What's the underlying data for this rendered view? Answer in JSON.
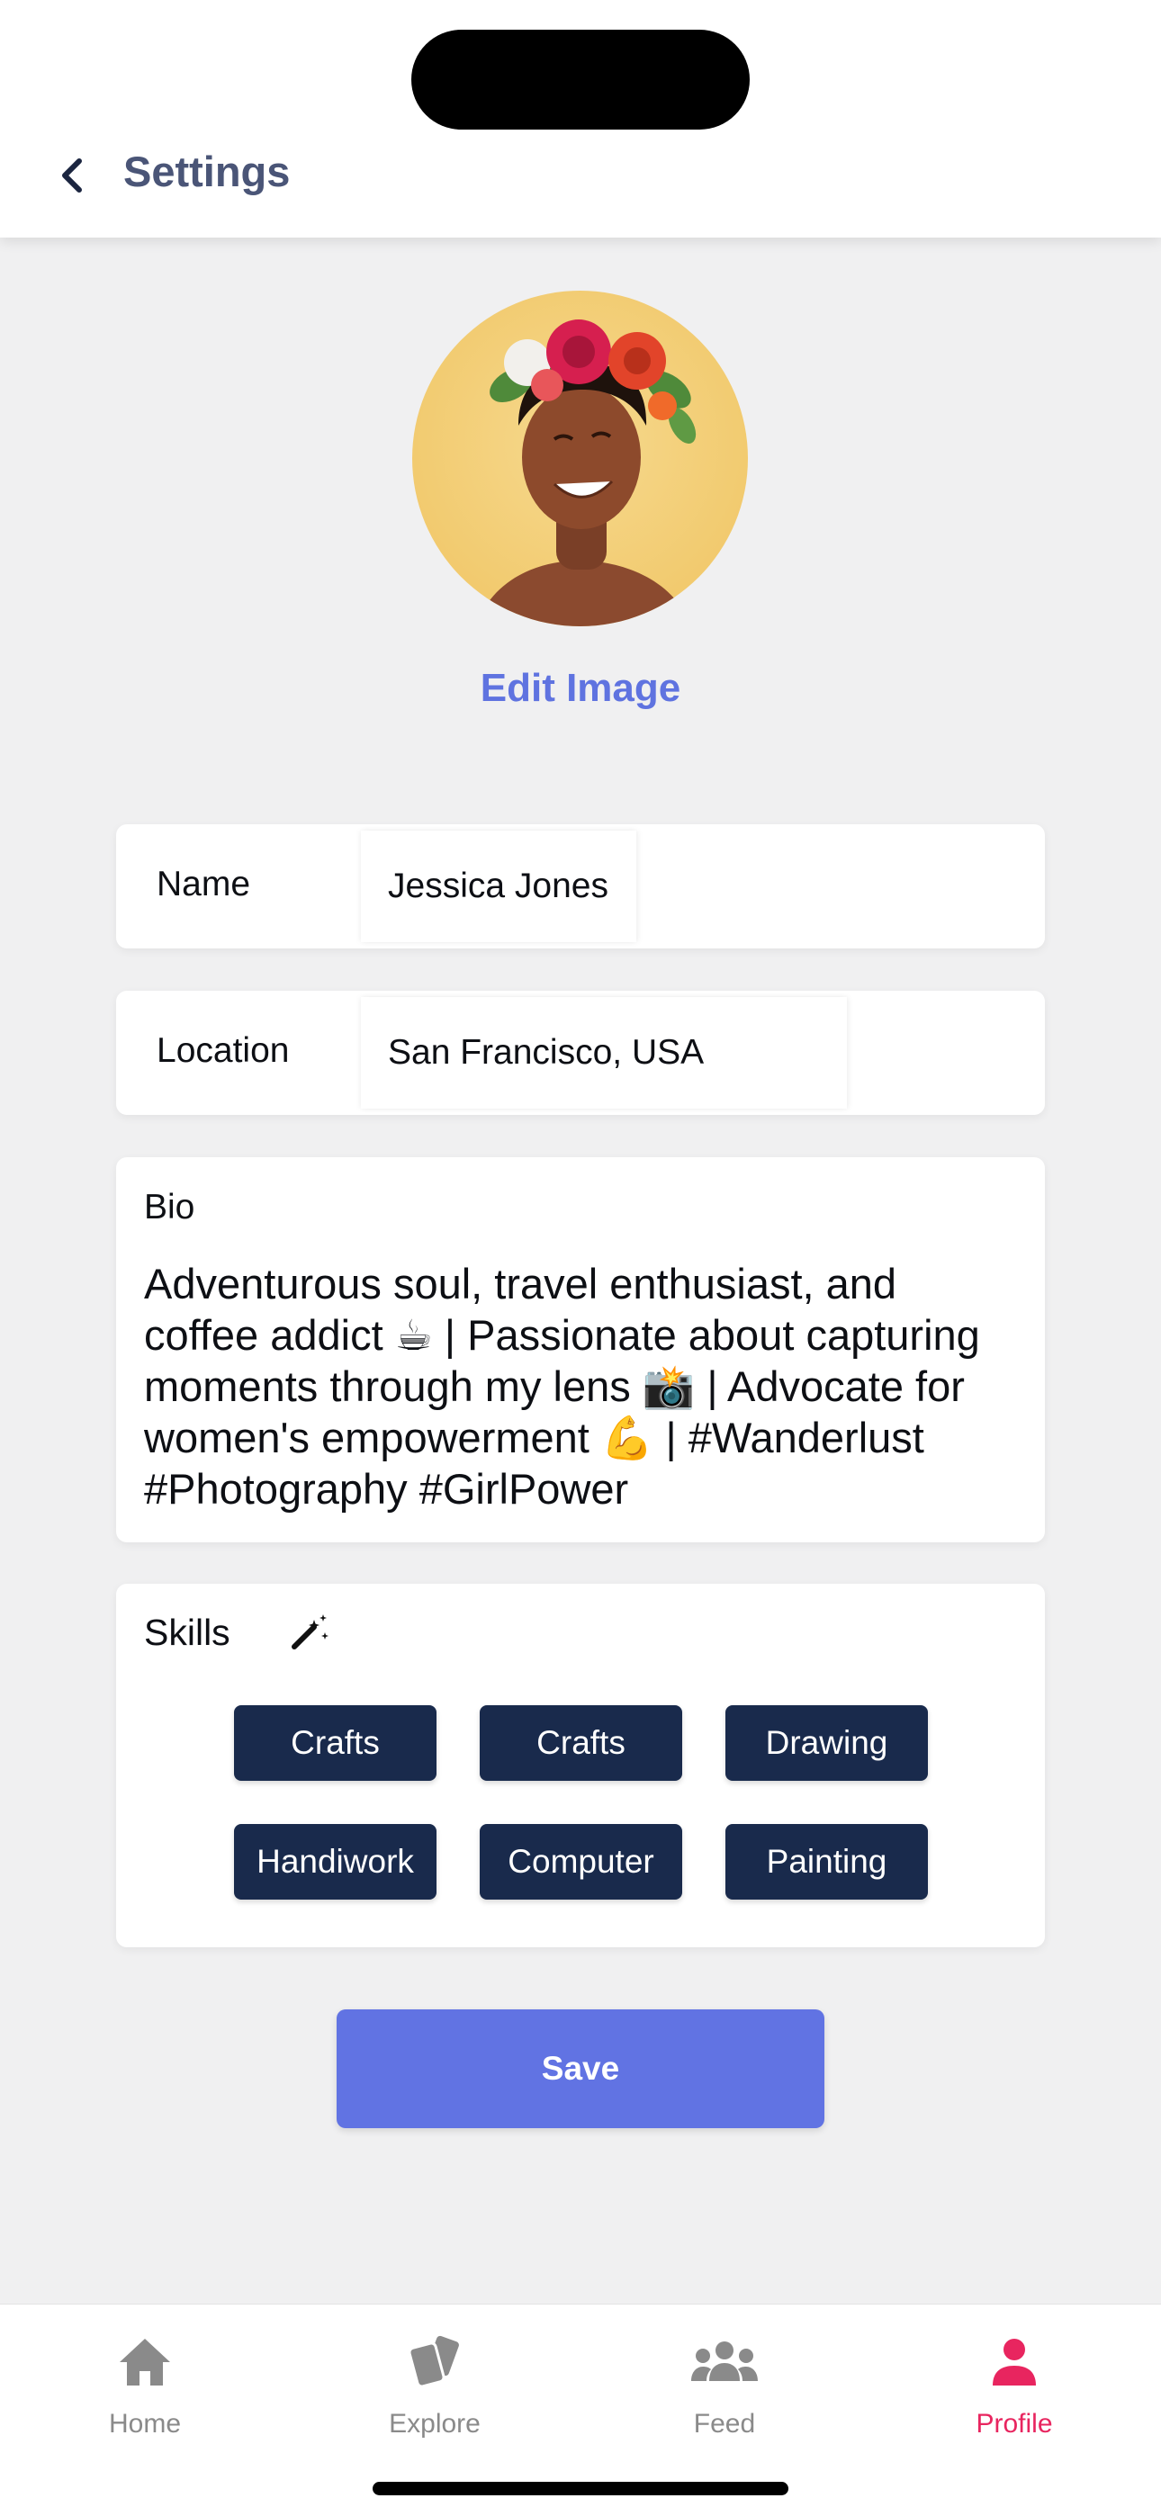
{
  "header": {
    "title": "Settings"
  },
  "profile": {
    "edit_image_label": "Edit Image"
  },
  "fields": {
    "name": {
      "label": "Name",
      "value": "Jessica Jones"
    },
    "location": {
      "label": "Location",
      "value": "San Francisco, USA"
    }
  },
  "bio": {
    "label": "Bio",
    "text": "Adventurous soul, travel enthusiast, and coffee addict ☕ | Passionate about capturing moments through my lens 📸 | Advocate for women's empowerment 💪 | #Wanderlust #Photography #GirlPower"
  },
  "skills": {
    "label": "Skills",
    "items": [
      "Crafts",
      "Crafts",
      "Drawing",
      "Handiwork",
      "Computer",
      "Painting"
    ]
  },
  "save_label": "Save",
  "tabs": [
    {
      "label": "Home",
      "icon": "home-icon"
    },
    {
      "label": "Explore",
      "icon": "cards-icon"
    },
    {
      "label": "Feed",
      "icon": "group-icon"
    },
    {
      "label": "Profile",
      "icon": "person-icon",
      "active": true
    }
  ],
  "colors": {
    "accent": "#5f73e0",
    "chip": "#192a4c",
    "active_tab": "#e8255f",
    "inactive_tab": "#8a8a8a",
    "background": "#f0f0f1"
  }
}
